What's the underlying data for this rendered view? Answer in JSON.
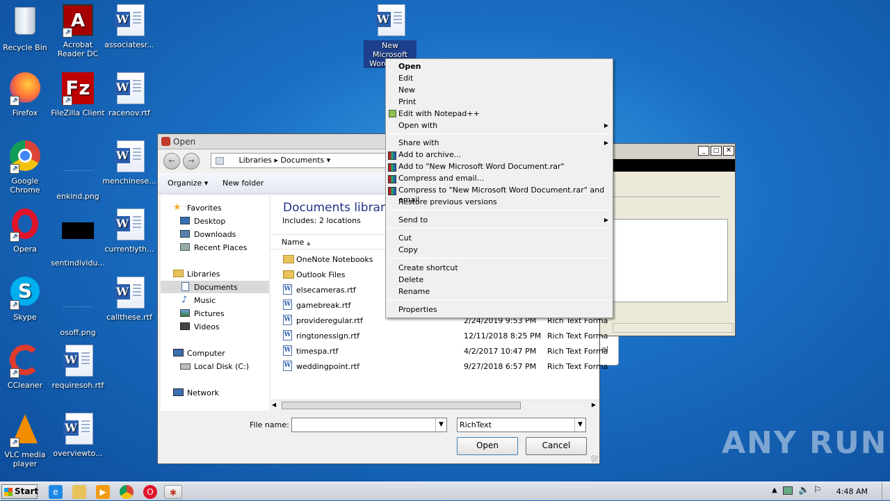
{
  "desktop_icons": [
    {
      "label": "Recycle Bin"
    },
    {
      "label": "Acrobat Reader DC"
    },
    {
      "label": "associatesr..."
    },
    {
      "label": "Firefox"
    },
    {
      "label": "FileZilla Client"
    },
    {
      "label": "racenov.rtf"
    },
    {
      "label": "Google Chrome"
    },
    {
      "label": "enkind.png"
    },
    {
      "label": "menchinese..."
    },
    {
      "label": "Opera"
    },
    {
      "label": "sentindividu..."
    },
    {
      "label": "currentlyth..."
    },
    {
      "label": "Skype"
    },
    {
      "label": "osoff.png"
    },
    {
      "label": "callthese.rtf"
    },
    {
      "label": "CCleaner"
    },
    {
      "label": "requiresoh.rtf"
    },
    {
      "label": "VLC media player"
    },
    {
      "label": "overviewto..."
    },
    {
      "label": "New Microsoft Word Docu"
    }
  ],
  "open_dialog": {
    "title": "Open",
    "breadcrumb": [
      "Libraries",
      "Documents"
    ],
    "toolbar": {
      "organize": "Organize",
      "new_folder": "New folder"
    },
    "nav": {
      "favorites": "Favorites",
      "desktop": "Desktop",
      "downloads": "Downloads",
      "recent": "Recent Places",
      "libraries": "Libraries",
      "documents": "Documents",
      "music": "Music",
      "pictures": "Pictures",
      "videos": "Videos",
      "computer": "Computer",
      "local_disk": "Local Disk (C:)",
      "network": "Network"
    },
    "library_title": "Documents library",
    "library_includes": "Includes:  2 locations",
    "column_name": "Name",
    "files": [
      {
        "name": "OneNote Notebooks",
        "date": "",
        "type": ""
      },
      {
        "name": "Outlook Files",
        "date": "",
        "type": ""
      },
      {
        "name": "elsecameras.rtf",
        "date": "",
        "type": ""
      },
      {
        "name": "gamebreak.rtf",
        "date": "",
        "type": ""
      },
      {
        "name": "provideregular.rtf",
        "date": "2/24/2019 9:53 PM",
        "type": "Rich Text Forma"
      },
      {
        "name": "ringtonessign.rtf",
        "date": "12/11/2018 8:25 PM",
        "type": "Rich Text Forma"
      },
      {
        "name": "timespa.rtf",
        "date": "4/2/2017 10:47 PM",
        "type": "Rich Text Forma"
      },
      {
        "name": "weddingpoint.rtf",
        "date": "9/27/2018 6:57 PM",
        "type": "Rich Text Forma"
      }
    ],
    "file_name_label": "File name:",
    "file_name_value": "",
    "file_type": "RichText",
    "open_button": "Open",
    "cancel_button": "Cancel"
  },
  "context_menu": {
    "items": [
      "Open",
      "Edit",
      "New",
      "Print",
      "Edit with Notepad++",
      "Open with",
      "Share with",
      "Add to archive...",
      "Add to \"New Microsoft Word Document.rar\"",
      "Compress and email...",
      "Compress to \"New Microsoft Word Document.rar\" and email",
      "Restore previous versions",
      "Send to",
      "Cut",
      "Copy",
      "Create shortcut",
      "Delete",
      "Rename",
      "Properties"
    ]
  },
  "background_window_fragment": "el",
  "taskbar": {
    "start": "Start",
    "time": "4:48 AM"
  },
  "watermark": "ANY RUN"
}
